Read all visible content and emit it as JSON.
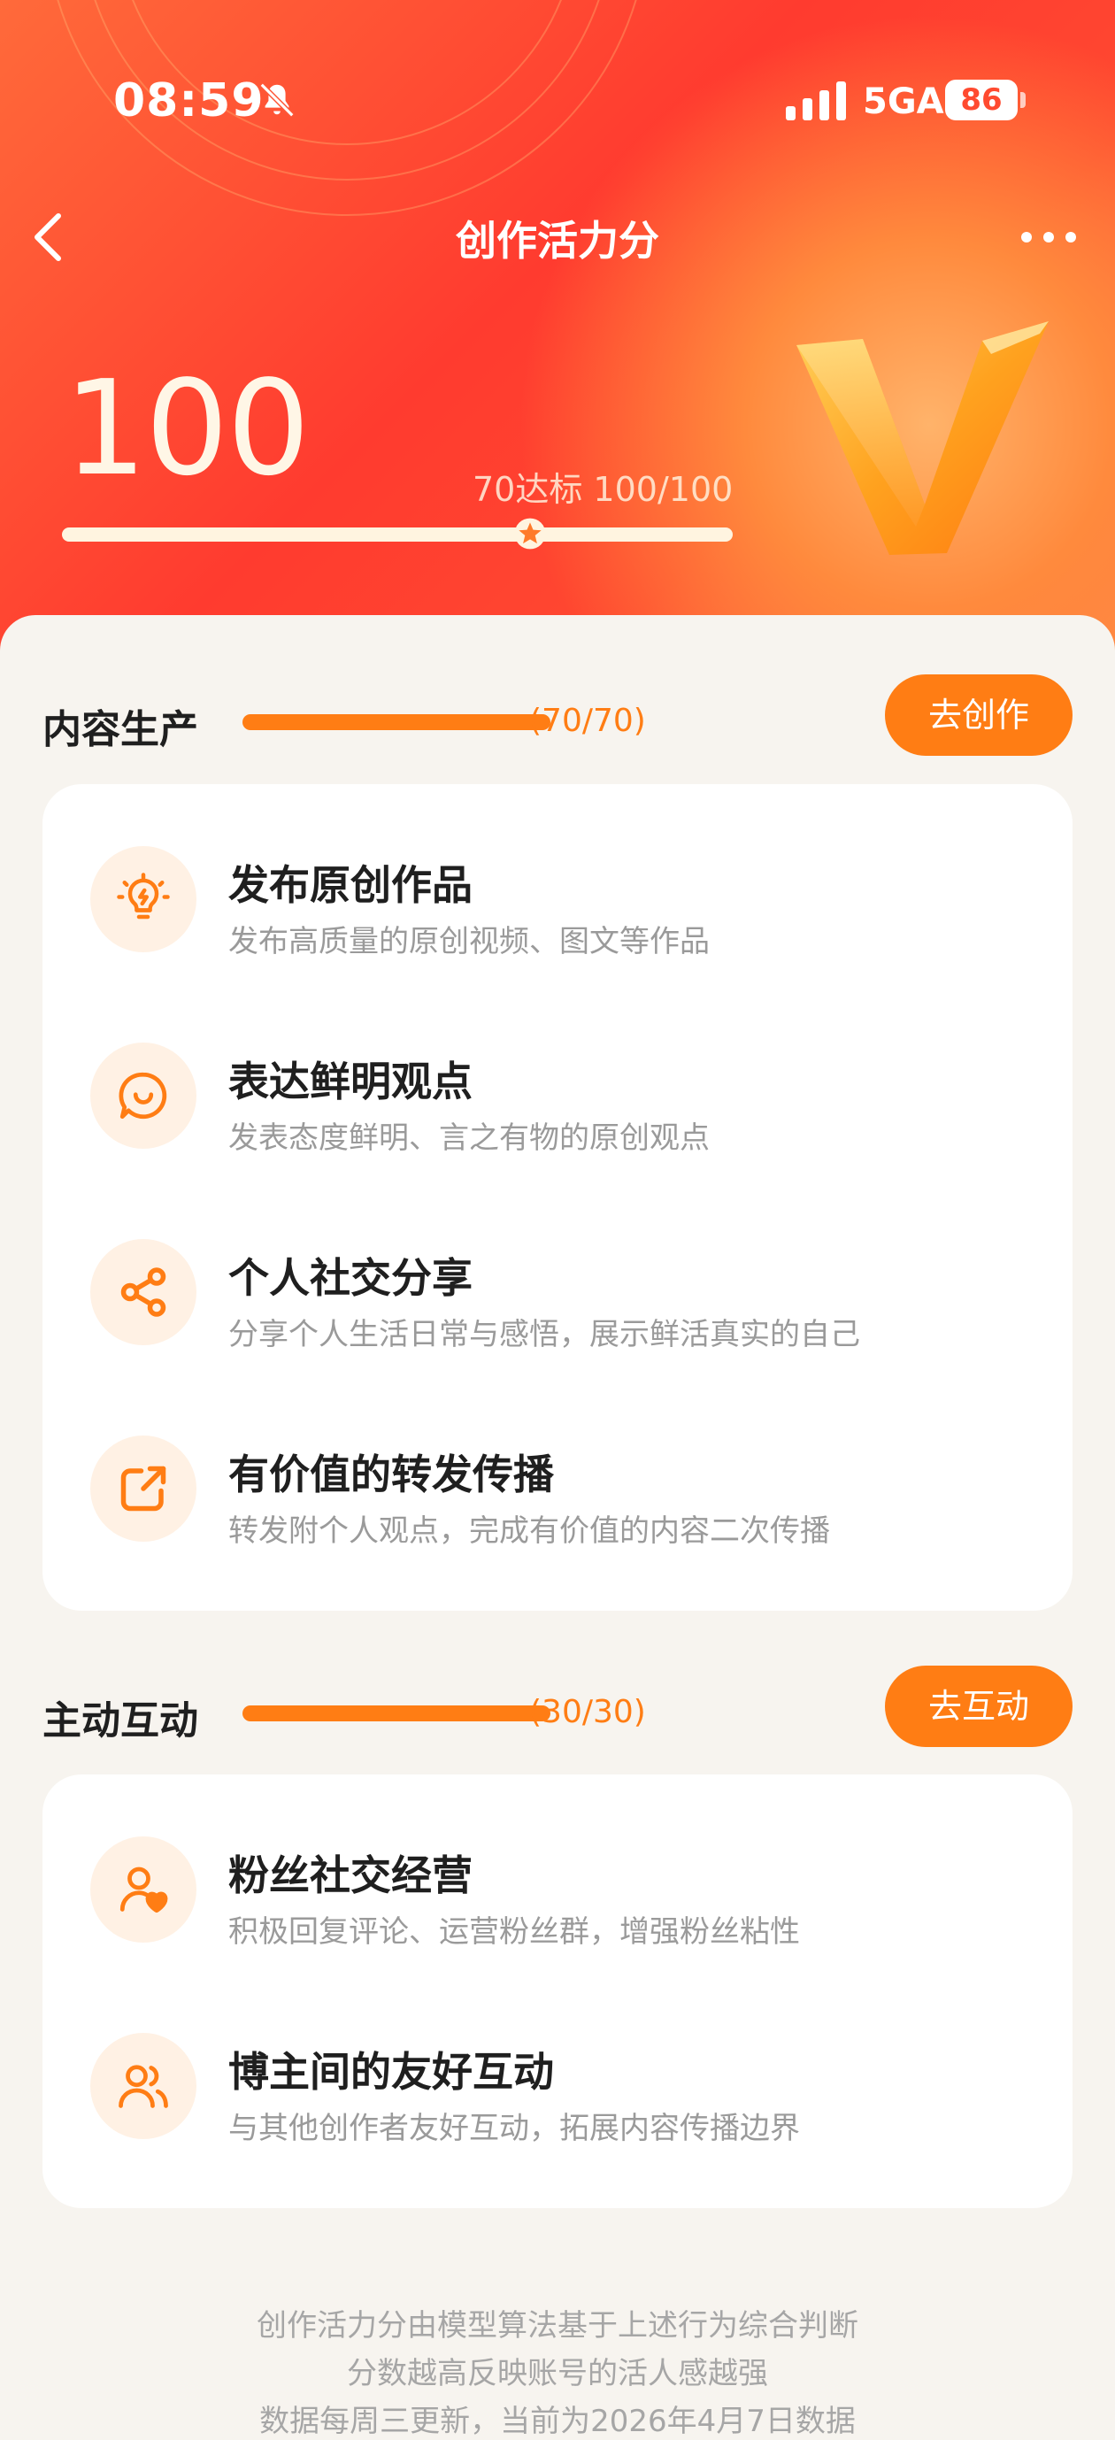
{
  "status_bar": {
    "time": "08:59",
    "network": "5GA",
    "battery": "86"
  },
  "nav": {
    "title": "创作活力分"
  },
  "score": {
    "value": "100",
    "target_label": "70达标 100/100",
    "progress": 1.0,
    "target_mark": 0.7
  },
  "sections": [
    {
      "title": "内容生产",
      "count": "(70/70)",
      "progress": 1.0,
      "button": "去创作",
      "items": [
        {
          "icon": "lightbulb-icon",
          "title": "发布原创作品",
          "desc": "发布高质量的原创视频、图文等作品"
        },
        {
          "icon": "chat-smile-icon",
          "title": "表达鲜明观点",
          "desc": "发表态度鲜明、言之有物的原创观点"
        },
        {
          "icon": "share-icon",
          "title": "个人社交分享",
          "desc": "分享个人生活日常与感悟，展示鲜活真实的自己"
        },
        {
          "icon": "forward-icon",
          "title": "有价值的转发传播",
          "desc": "转发附个人观点，完成有价值的内容二次传播"
        }
      ]
    },
    {
      "title": "主动互动",
      "count": "(30/30)",
      "progress": 1.0,
      "button": "去互动",
      "items": [
        {
          "icon": "fan-heart-icon",
          "title": "粉丝社交经营",
          "desc": "积极回复评论、运营粉丝群，增强粉丝粘性"
        },
        {
          "icon": "group-icon",
          "title": "博主间的友好互动",
          "desc": "与其他创作者友好互动，拓展内容传播边界"
        }
      ]
    }
  ],
  "footer": {
    "line1": "创作活力分由模型算法基于上述行为综合判断",
    "line2": "分数越高反映账号的活人感越强",
    "line3": "数据每周三更新，当前为2026年4月7日数据"
  },
  "colors": {
    "accent": "#ff7d14",
    "hero_red": "#ff3b2f",
    "hero_orange": "#ff6a3a"
  }
}
